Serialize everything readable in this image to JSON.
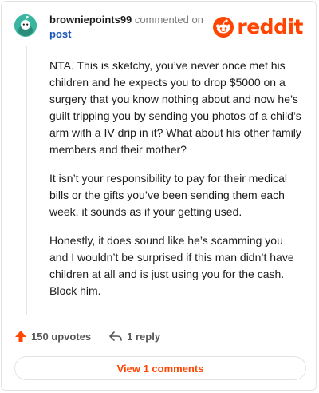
{
  "header": {
    "username": "browniepoints99",
    "action_text": "commented on",
    "post_link": "post"
  },
  "brand": {
    "wordmark": "reddit",
    "color": "#ff4500",
    "icon": "reddit-snoo-icon"
  },
  "avatar": {
    "color": "#3ab5a0"
  },
  "comment": {
    "paragraphs": [
      "NTA. This is sketchy, you’ve never once met his children and he expects you to drop $5000 on a surgery that you know nothing about and now he’s guilt tripping you by sending you photos of a child’s arm with a IV drip in it? What about his other family members and their mother?",
      "It isn’t your responsibility to pay for their medical bills or the gifts you’ve been sending them each week, it sounds as if your getting used.",
      "Honestly, it does sound like he’s scamming you and I wouldn’t be surprised if this man didn’t have children at all and is just using you for the cash. Block him."
    ]
  },
  "actions": {
    "upvotes_label": "150 upvotes",
    "upvote_icon": "upvote-arrow-icon",
    "reply_label": "1 reply",
    "reply_icon": "reply-arrow-icon"
  },
  "footer": {
    "view_comments_label": "View 1 comments"
  }
}
